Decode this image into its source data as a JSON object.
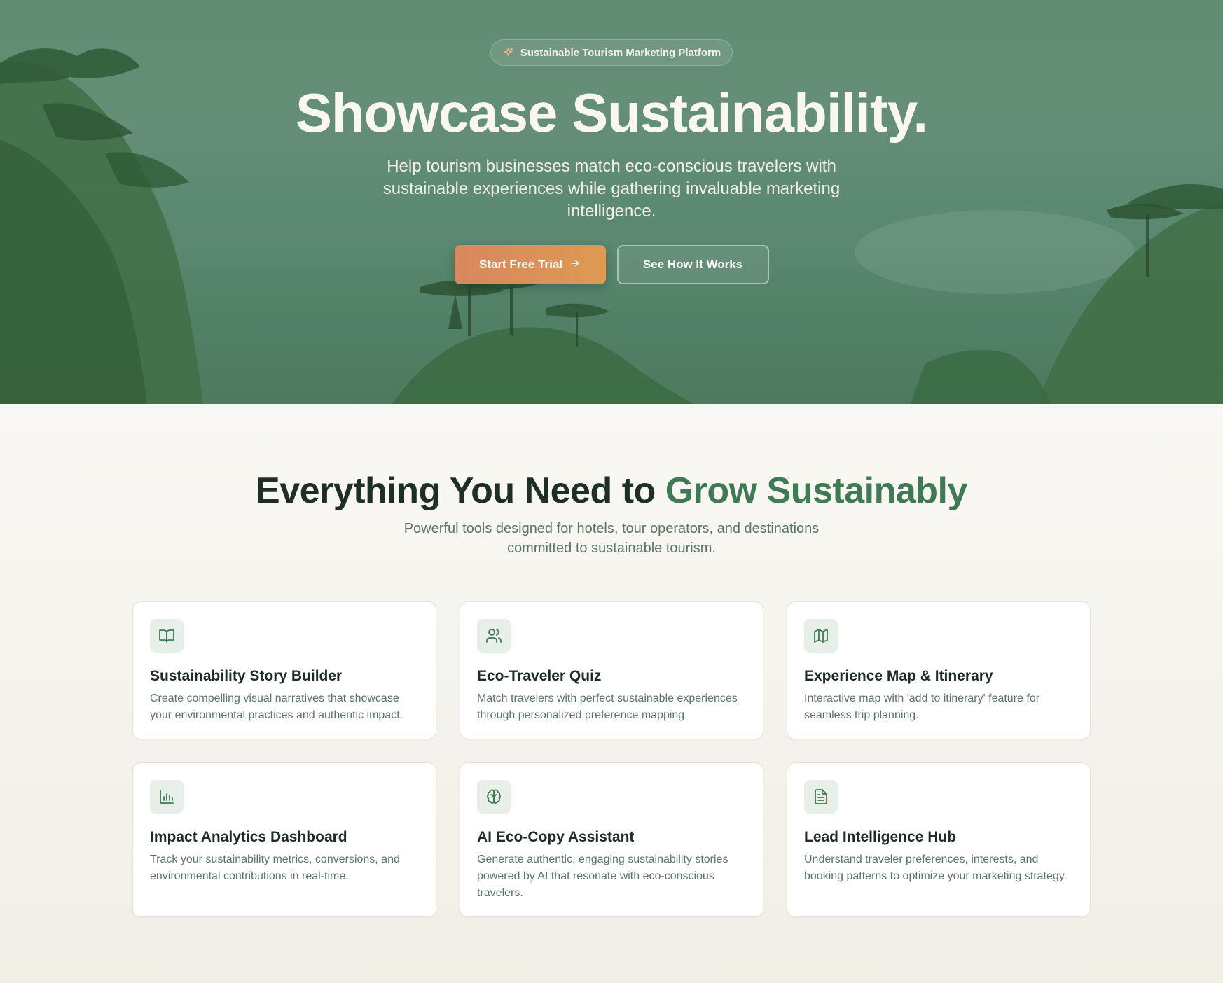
{
  "hero": {
    "badge_icon": "sparkles-icon",
    "badge": "Sustainable Tourism Marketing Platform",
    "title": "Showcase Sustainability.",
    "subtitle": "Help tourism businesses match eco-conscious travelers with sustainable experiences while gathering invaluable marketing intelligence.",
    "primary_button": "Start Free Trial",
    "primary_button_icon": "arrow-right-icon",
    "secondary_button": "See How It Works"
  },
  "features": {
    "title_part1": "Everything You Need to ",
    "title_accent": "Grow Sustainably",
    "subtitle": "Powerful tools designed for hotels, tour operators, and destinations committed to sustainable tourism.",
    "cards": [
      {
        "icon": "book-open-icon",
        "title": "Sustainability Story Builder",
        "description": "Create compelling visual narratives that showcase your environmental practices and authentic impact."
      },
      {
        "icon": "users-icon",
        "title": "Eco-Traveler Quiz",
        "description": "Match travelers with perfect sustainable experiences through personalized preference mapping."
      },
      {
        "icon": "map-icon",
        "title": "Experience Map & Itinerary",
        "description": "Interactive map with 'add to itinerary' feature for seamless trip planning."
      },
      {
        "icon": "bar-chart-icon",
        "title": "Impact Analytics Dashboard",
        "description": "Track your sustainability metrics, conversions, and environmental contributions in real-time."
      },
      {
        "icon": "brain-icon",
        "title": "AI Eco-Copy Assistant",
        "description": "Generate authentic, engaging sustainability stories powered by AI that resonate with eco-conscious travelers."
      },
      {
        "icon": "file-text-icon",
        "title": "Lead Intelligence Hub",
        "description": "Understand traveler preferences, interests, and booking patterns to optimize your marketing strategy."
      }
    ]
  },
  "colors": {
    "accent_green": "#3f7a54",
    "primary_button_start": "#d9875f",
    "primary_button_end": "#dd9a52",
    "hero_overlay": "#5f8d72"
  }
}
